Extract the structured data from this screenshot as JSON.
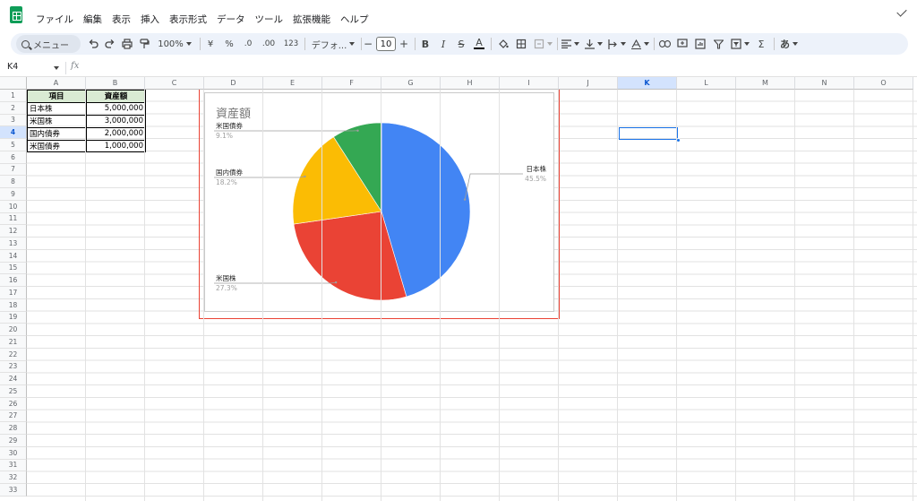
{
  "menu": {
    "items": [
      "ファイル",
      "編集",
      "表示",
      "挿入",
      "表示形式",
      "データ",
      "ツール",
      "拡張機能",
      "ヘルプ"
    ]
  },
  "toolbar": {
    "search_label": "メニュー",
    "zoom": "100%",
    "currency": "¥",
    "percent": "%",
    "decimal_decrease": ".0",
    "decimal_increase": ".00",
    "more_formats": "123",
    "font": "デフォ...",
    "font_size": "10",
    "minus": "−",
    "plus": "+",
    "bold": "B",
    "italic": "I",
    "strike": "S",
    "text_color": "A",
    "function": "Σ",
    "input_tool": "あ",
    "icons": [
      "search-icon",
      "undo-icon",
      "redo-icon",
      "print-icon",
      "paint-format-icon",
      "fill-color-icon",
      "borders-icon",
      "merge-cells-icon",
      "align-left-icon",
      "valign-bottom-icon",
      "text-wrap-icon",
      "text-rotation-icon",
      "link-icon",
      "comment-icon",
      "chart-icon",
      "filter-icon",
      "filter-views-icon"
    ]
  },
  "formula_bar": {
    "name_box": "K4",
    "fx": "fx"
  },
  "columns": [
    "A",
    "B",
    "C",
    "D",
    "E",
    "F",
    "G",
    "H",
    "I",
    "J",
    "K",
    "L",
    "M",
    "N",
    "O"
  ],
  "rows": [
    "1",
    "2",
    "3",
    "4",
    "5",
    "6",
    "7",
    "8",
    "9",
    "10",
    "11",
    "12",
    "13",
    "14",
    "15",
    "16",
    "17",
    "18",
    "19",
    "20",
    "21",
    "22",
    "23",
    "24",
    "25",
    "26",
    "27",
    "28",
    "29",
    "30",
    "31",
    "32",
    "33"
  ],
  "selected": {
    "column": "K",
    "row": "4"
  },
  "table": {
    "headers": [
      "項目",
      "資産額"
    ],
    "rows": [
      [
        "日本株",
        "5,000,000"
      ],
      [
        "米国株",
        "3,000,000"
      ],
      [
        "国内債券",
        "2,000,000"
      ],
      [
        "米国債券",
        "1,000,000"
      ]
    ]
  },
  "chart_data": {
    "type": "pie",
    "title": "資産額",
    "slices": [
      {
        "label": "日本株",
        "value": 5000000,
        "percent": "45.5%",
        "color": "#4285f4"
      },
      {
        "label": "米国株",
        "value": 3000000,
        "percent": "27.3%",
        "color": "#ea4335"
      },
      {
        "label": "国内債券",
        "value": 2000000,
        "percent": "18.2%",
        "color": "#fbbc04"
      },
      {
        "label": "米国債券",
        "value": 1000000,
        "percent": "9.1%",
        "color": "#34a853"
      }
    ],
    "legend": "labels"
  },
  "colors": {
    "header_fill": "#d9ead3",
    "selection": "#1a73e8",
    "chart_selection_border": "#ea4335"
  }
}
